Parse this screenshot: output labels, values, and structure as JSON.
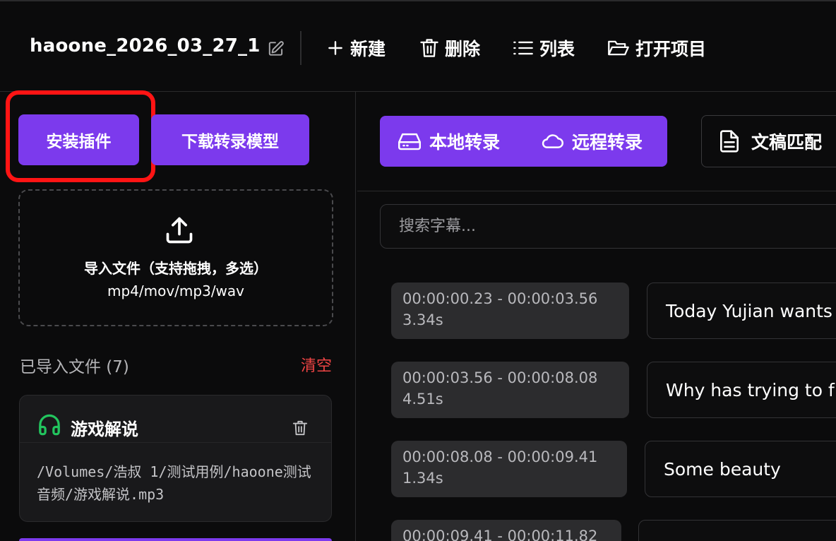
{
  "header": {
    "project_name": "haoone_2026_03_27_1",
    "new_label": "新建",
    "delete_label": "删除",
    "list_label": "列表",
    "open_project_label": "打开项目"
  },
  "left": {
    "install_plugin_label": "安装插件",
    "download_model_label": "下载转录模型",
    "dropzone": {
      "line1": "导入文件（支持拖拽，多选）",
      "line2": "mp4/mov/mp3/wav"
    },
    "imported_title": "已导入文件 (7)",
    "clear_label": "清空",
    "file": {
      "name": "游戏解说",
      "path": "/Volumes/浩叔 1/测试用例/haoone测试音频/游戏解说.mp3"
    }
  },
  "right": {
    "local_transcribe_label": "本地转录",
    "remote_transcribe_label": "远程转录",
    "script_match_label": "文稿匹配",
    "search_placeholder": "搜索字幕...",
    "segments": [
      {
        "range": "00:00:00.23 - 00:00:03.56",
        "duration": "3.34s",
        "text": "Today Yujian wants"
      },
      {
        "range": "00:00:03.56 - 00:00:08.08",
        "duration": "4.51s",
        "text": "Why has trying to f"
      },
      {
        "range": "00:00:08.08 - 00:00:09.41",
        "duration": "1.34s",
        "text": "Some beauty"
      },
      {
        "range": "00:00:09.41 - 00:00:11.82",
        "duration": "",
        "text": ""
      }
    ]
  },
  "colors": {
    "accent": "#7c3aed",
    "danger": "#ef4444",
    "highlight": "#ff1414",
    "file_icon": "#22c55e",
    "background": "#0b0b0c"
  }
}
